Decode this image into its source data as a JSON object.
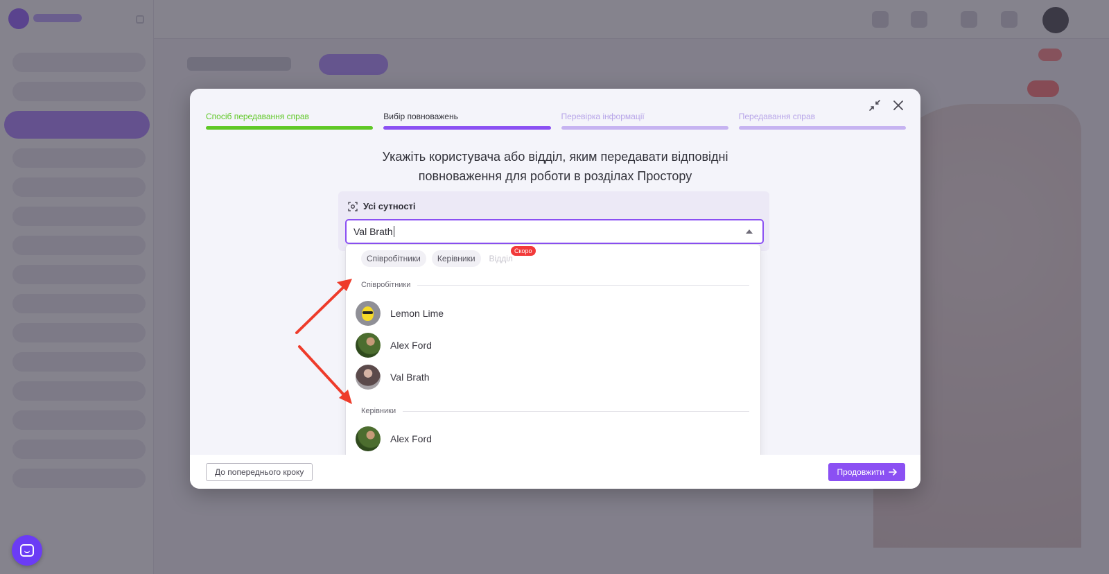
{
  "modal": {
    "steps": [
      {
        "label": "Спосіб передавання справ",
        "state": "done"
      },
      {
        "label": "Вибір повноважень",
        "state": "current"
      },
      {
        "label": "Перевірка інформації",
        "state": "pending"
      },
      {
        "label": "Передавання справ",
        "state": "pending"
      }
    ],
    "heading_line1": "Укажіть користувача або відділ, яким передавати відповідні",
    "heading_line2": "повноваження для роботи в розділах Простору",
    "entity": {
      "title": "Усі сутності",
      "select_value": "Val Brath"
    },
    "dropdown": {
      "filters": [
        {
          "label": "Співробітники"
        },
        {
          "label": "Керівники"
        },
        {
          "label": "Відділ",
          "disabled": true
        }
      ],
      "soon_badge": "Скоро",
      "groups": [
        {
          "label": "Співробітники",
          "users": [
            {
              "name": "Lemon Lime",
              "avatar": "lemon"
            },
            {
              "name": "Alex Ford",
              "avatar": "alex"
            },
            {
              "name": "Val Brath",
              "avatar": "val"
            }
          ]
        },
        {
          "label": "Керівники",
          "users": [
            {
              "name": "Alex Ford",
              "avatar": "alex"
            }
          ]
        }
      ]
    },
    "footer": {
      "back_label": "До попереднього кроку",
      "next_label": "Продовжити"
    }
  },
  "colors": {
    "accent": "#8b50f3",
    "success": "#5fc826",
    "annotation_arrow": "#ee3b2a",
    "soon_badge": "#f23a3a"
  }
}
